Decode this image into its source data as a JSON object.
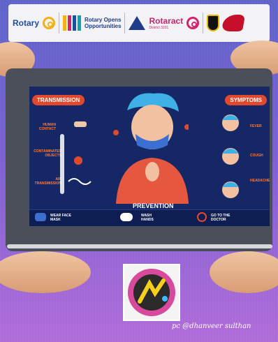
{
  "banner": {
    "rotary": "Rotary",
    "roo_line1": "Rotary Opens",
    "roo_line2": "Opportunities",
    "rotaract": "Rotaract",
    "rotaract_sub": "District 3201",
    "colors": {
      "rotary_blue": "#1d4fa1",
      "rotary_gold": "#f2b019",
      "rotaract_pink": "#c8246b"
    }
  },
  "infographic": {
    "transmission": "TRANSMISSION",
    "symptoms": "SYMPTOMS",
    "human_contact": "HUMAN CONTACT",
    "contaminated": "CONTAMINATED OBJECTS",
    "air": "AIR TRANSMISSION",
    "fever": "FEVER",
    "cough": "COUGH",
    "headache": "HEADACHE",
    "prevention": "PREVENTION",
    "wear": "WEAR FACE MASK",
    "wash": "WASH HANDS",
    "doctor": "GO TO THE DOCTOR"
  },
  "credit": "pc @dhanveer sulthan"
}
